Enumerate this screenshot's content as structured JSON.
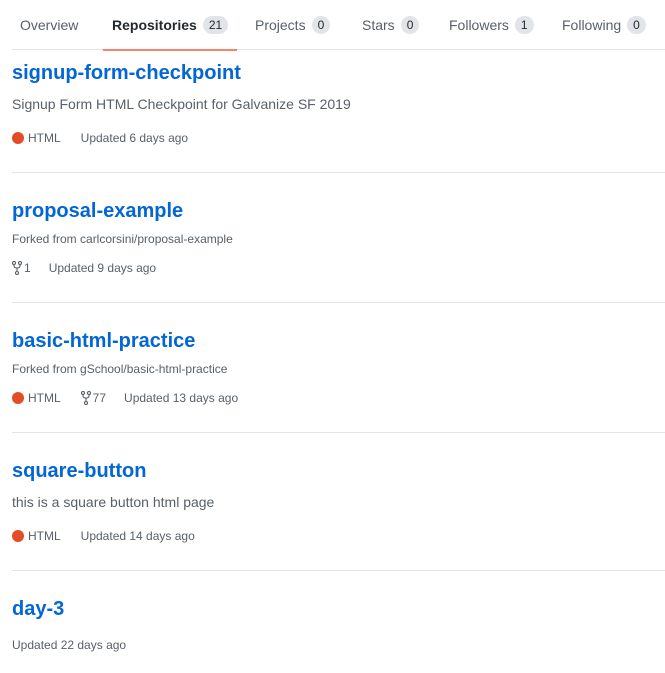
{
  "tabs": [
    {
      "label": "Overview",
      "count": null
    },
    {
      "label": "Repositories",
      "count": "21"
    },
    {
      "label": "Projects",
      "count": "0"
    },
    {
      "label": "Stars",
      "count": "0"
    },
    {
      "label": "Followers",
      "count": "1"
    },
    {
      "label": "Following",
      "count": "0"
    }
  ],
  "selected_tab": "Repositories",
  "accent_color": "#f9826c",
  "link_color": "#0366d6",
  "repos": [
    {
      "name": "signup-form-checkpoint",
      "description": "Signup Form HTML Checkpoint for Galvanize SF 2019",
      "language": "HTML",
      "language_color": "#e34c26",
      "updated": "Updated 6 days ago"
    },
    {
      "name": "proposal-example",
      "forked_from": "Forked from carlcorsini/proposal-example",
      "forks": "1",
      "updated": "Updated 9 days ago"
    },
    {
      "name": "basic-html-practice",
      "forked_from": "Forked from gSchool/basic-html-practice",
      "language": "HTML",
      "language_color": "#e34c26",
      "forks": "77",
      "updated": "Updated 13 days ago"
    },
    {
      "name": "square-button",
      "description": "this is a square button html page",
      "language": "HTML",
      "language_color": "#e34c26",
      "updated": "Updated 14 days ago"
    },
    {
      "name": "day-3",
      "updated": "Updated 22 days ago"
    }
  ],
  "icons": {
    "fork": "repo-forked-icon"
  }
}
